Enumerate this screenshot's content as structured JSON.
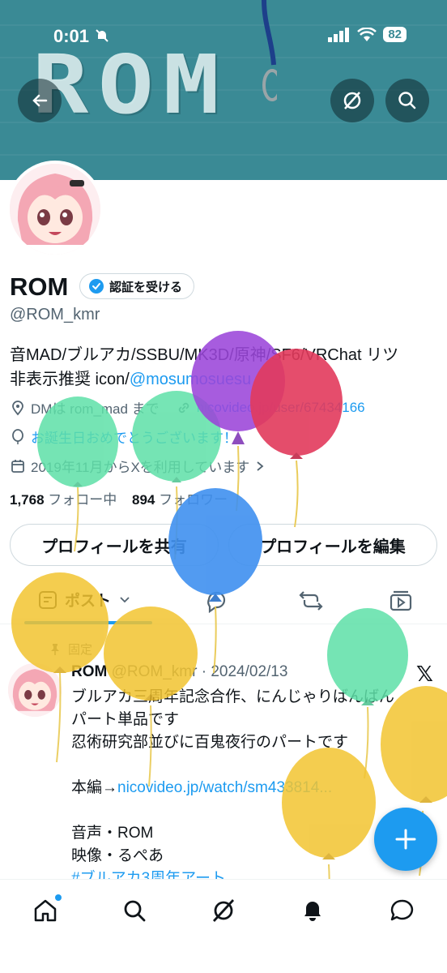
{
  "status": {
    "time": "0:01",
    "battery": "82"
  },
  "banner": {
    "text": "ROM"
  },
  "profile": {
    "name": "ROM",
    "verify_label": "認証を受ける",
    "handle": "@ROM_kmr",
    "bio_line1": "音MAD/ブルアカ/SSBU/MK3D/原神/SF6/VRChat リツ",
    "bio_line2_prefix": "非表示推奨 icon/",
    "bio_line2_link": "@mosumosuesu",
    "dm_text": "DMは rom_mad まで",
    "website": "nicovideo.jp/user/67434166",
    "birthday": "お誕生日おめでとうございます！",
    "joined": "2019年11月からXを利用しています",
    "following_count": "1,768",
    "following_label": "フォロー中",
    "followers_count": "894",
    "followers_label": "フォロワー"
  },
  "buttons": {
    "share": "プロフィールを共有",
    "edit": "プロフィールを編集"
  },
  "tabs": {
    "posts": "ポスト"
  },
  "post": {
    "pinned": "固定",
    "author": "ROM",
    "handle_date": "@ROM_kmr · 2024/02/13",
    "line1": "ブルアカ三周年記念合作、にんじゃりばんばん",
    "line2": "パート単品です",
    "line3": "忍術研究部並びに百鬼夜行のパートです",
    "line4_prefix": "本編→",
    "line4_link": "nicovideo.jp/watch/sm433814...",
    "line5": "音声・ROM",
    "line6": "映像・るぺあ",
    "line7": "#ブルアカ3周年アート"
  },
  "colors": {
    "accent": "#1d9bf0",
    "banner": "#3a8a95",
    "text": "#0f1419",
    "muted": "#536471"
  },
  "icons": [
    "back-arrow-icon",
    "grok-icon",
    "search-icon",
    "location-icon",
    "link-icon",
    "balloon-icon",
    "calendar-icon",
    "chevron-right-icon",
    "repost-icon",
    "media-icon",
    "home-icon",
    "bell-icon",
    "messages-icon",
    "plus-icon",
    "x-logo-icon"
  ]
}
